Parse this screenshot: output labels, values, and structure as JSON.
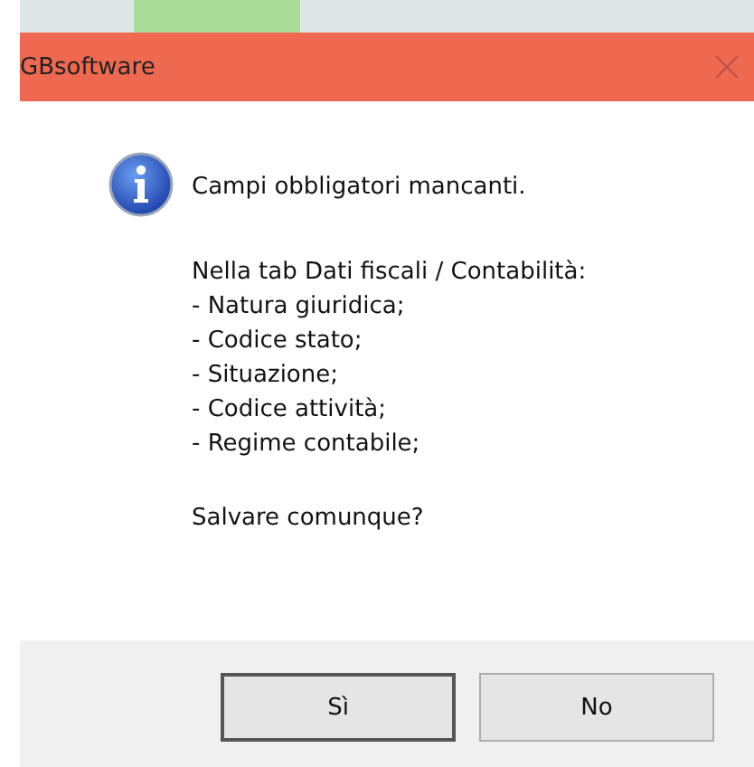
{
  "window": {
    "title": "GBsoftware"
  },
  "message": {
    "heading": "Campi obbligatori mancanti.",
    "details": [
      "Nella tab Dati fiscali / Contabilità:",
      "- Natura giuridica;",
      "- Codice stato;",
      "- Situazione;",
      "- Codice attività;",
      "- Regime contabile;"
    ],
    "question": "Salvare comunque?"
  },
  "buttons": [
    {
      "label": "Sì",
      "focused": true
    },
    {
      "label": "No",
      "focused": false
    }
  ]
}
